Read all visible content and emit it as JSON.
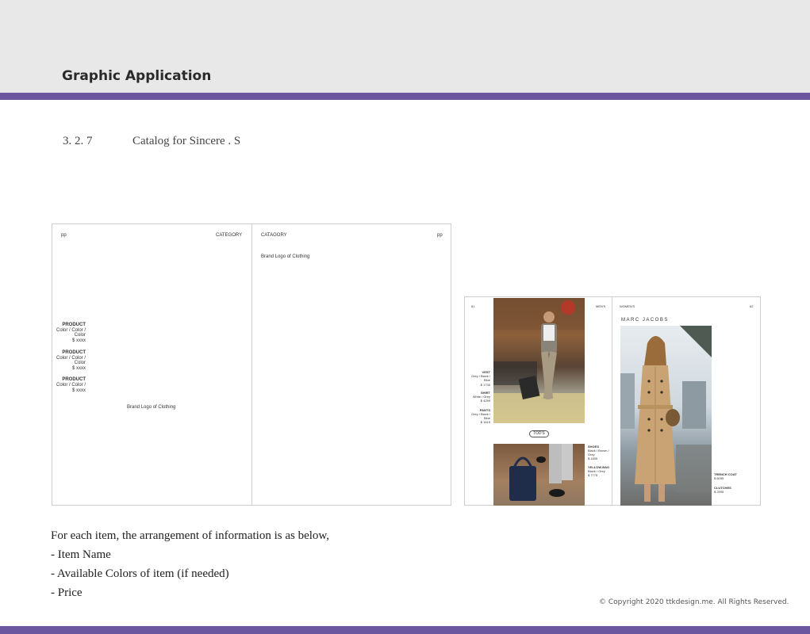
{
  "header": {
    "title": "Graphic Application"
  },
  "section": {
    "number": "3. 2. 7",
    "title": "Catalog for Sincere . S"
  },
  "wireframe": {
    "left_page_num": "pp",
    "left_category": "CATEGORY",
    "right_category": "CATAGORY",
    "right_page_num": "pp",
    "right_brand": "Brand Logo of Clothing",
    "left_brand": "Brand Logo of Clothing",
    "products": [
      {
        "name": "PRODUCT",
        "colors_1": "Color / Color /",
        "colors_2": "Color",
        "price": "$ xxxx"
      },
      {
        "name": "PRODUCT",
        "colors_1": "Color / Color /",
        "colors_2": "Color",
        "price": "$ xxxx"
      },
      {
        "name": "PRODUCT",
        "colors_1": "Color / Color /",
        "colors_2": "",
        "price": "$ xxxx"
      }
    ]
  },
  "sample": {
    "left_page_num": "61",
    "left_category": "MEN'S",
    "right_category": "WOMEN'S",
    "right_page_num": "62",
    "brand_right": "MARC JACOBS",
    "brand_left": "TOD'S",
    "left_items": [
      {
        "name": "VEST",
        "colors": "Grey / Black / Blue",
        "price": "$ 1735"
      },
      {
        "name": "SHIRT",
        "colors": "White / Grey",
        "price": "$ 4299"
      },
      {
        "name": "PANTS",
        "colors": "Grey / Black / Blue",
        "price": "$ 1615"
      }
    ],
    "bottom_items": [
      {
        "name": "SHOES",
        "colors": "Black / Brown / Grey",
        "price": "$ 1805"
      },
      {
        "name": "YELLOW BAG",
        "colors": "Black / Grey",
        "price": "$ 7775"
      }
    ],
    "right_items": [
      {
        "name": "TRENCH COAT",
        "price": "$ 6095"
      },
      {
        "name": "CLUTCHES",
        "price": "$ 2995"
      }
    ]
  },
  "description": {
    "intro": "For each item, the arrangement of information is as below,",
    "line1": "- Item Name",
    "line2": "- Available Colors of item (if needed)",
    "line3": "- Price"
  },
  "footer": {
    "copyright": "© Copyright 2020 ttkdesign.me. All Rights Reserved."
  }
}
